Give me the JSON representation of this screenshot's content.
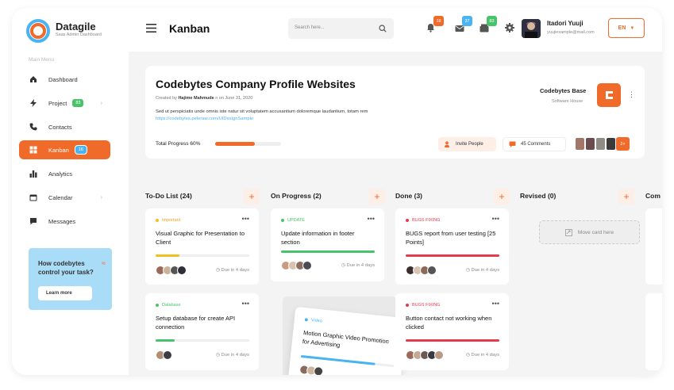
{
  "brand": {
    "name": "Datagile",
    "subtitle": "Saas Admin Dashboard"
  },
  "sidebar": {
    "menu_title": "Main Menu",
    "items": [
      {
        "label": "Dashboard",
        "icon": "home-icon"
      },
      {
        "label": "Project",
        "icon": "bolt-icon",
        "badge": "83"
      },
      {
        "label": "Contacts",
        "icon": "phone-icon"
      },
      {
        "label": "Kanban",
        "icon": "grid-icon",
        "badge": "16",
        "active": true
      },
      {
        "label": "Analytics",
        "icon": "bar-chart-icon"
      },
      {
        "label": "Calendar",
        "icon": "calendar-icon"
      },
      {
        "label": "Messages",
        "icon": "chat-icon"
      }
    ],
    "promo": {
      "text": "How codebytes control your task?",
      "button": "Learn more"
    }
  },
  "header": {
    "title": "Kanban",
    "search_placeholder": "Search here...",
    "notifications": {
      "bell": "18",
      "mail": "37",
      "box": "83"
    },
    "user": {
      "name": "Itadori Yuuji",
      "email": "yuujiexample@mail.com"
    },
    "language": "EN"
  },
  "project": {
    "title": "Codebytes Company Profile Websites",
    "created_prefix": "Created by ",
    "created_by": "Hajime Mahmude",
    "created_suffix": " n on June 31, 2020",
    "description": "Sed ut perspiciatis unde omnis iste natur sit voluptatem accusantium doloremque laudantium, totam rem ",
    "link": "https://codebytes.peleraw.com/UIDesignSample",
    "progress_label": "Total Progress 60%",
    "progress": 0.6,
    "invite": "Invite People",
    "comments": "45 Comments",
    "more_members": "2+",
    "company": "Codebytes Base",
    "company_type": "Software House"
  },
  "columns": [
    {
      "title": "To-Do List (24)"
    },
    {
      "title": "On Progress (2)"
    },
    {
      "title": "Done (3)"
    },
    {
      "title": "Revised (0)"
    },
    {
      "title": "Com"
    }
  ],
  "cards": {
    "c1": {
      "tag": "Important",
      "tag_color": "#f0c020",
      "title": "Visual Graphic for Presentation to Client",
      "progress": 0.25,
      "bar_color": "#f0c020",
      "due": "Due in 4 days"
    },
    "c2": {
      "tag": "Database",
      "tag_color": "#47c46a",
      "title": "Setup database for create API connection",
      "progress": 0.2,
      "bar_color": "#47c46a",
      "due": "Due in 4 days"
    },
    "c3": {
      "tag": "UPDATE",
      "tag_color": "#47c46a",
      "title": "Update information in footer section",
      "progress": 1.0,
      "bar_color": "#47c46a",
      "due": "Due in 4 days"
    },
    "c4": {
      "tag": "Video",
      "tag_color": "#4ab4f1",
      "title": "Motion Graphic Video Promotion for Advertising",
      "progress": 0.8,
      "bar_color": "#4ab4f1"
    },
    "c5": {
      "tag": "BUGS FIXING",
      "tag_color": "#e8394e",
      "title": "BUGS report from user testing [25 Points]",
      "progress": 1.0,
      "bar_color": "#e8394e",
      "due": "Due in 4 days"
    },
    "c6": {
      "tag": "BUGS FIXING",
      "tag_color": "#e8394e",
      "title": "Button contact not working when clicked",
      "progress": 1.0,
      "bar_color": "#e8394e",
      "due": "Due in 4 days"
    }
  },
  "placeholder": "Move card here",
  "colors": {
    "accent": "#f06a2a",
    "green": "#47c46a",
    "blue": "#4ab4f1",
    "red": "#e8394e",
    "yellow": "#f0c020"
  }
}
